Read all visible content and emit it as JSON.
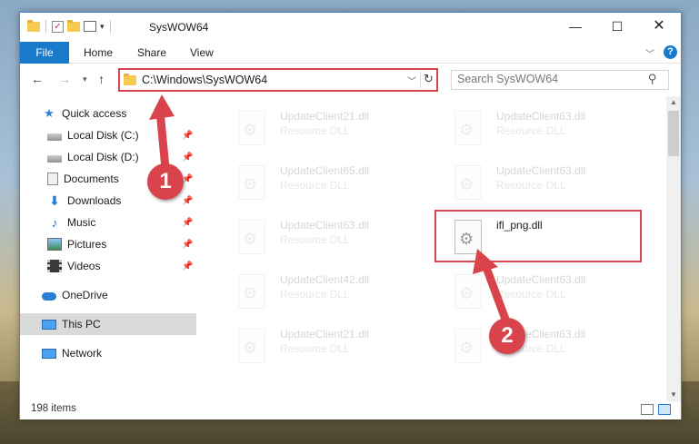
{
  "window": {
    "title": "SysWOW64",
    "minimize_glyph": "—",
    "maximize_glyph": "☐",
    "close_glyph": "✕"
  },
  "ribbon": {
    "tabs": [
      "File",
      "Home",
      "Share",
      "View"
    ],
    "help_glyph": "?"
  },
  "navigation": {
    "address": "C:\\Windows\\SysWOW64",
    "search_placeholder": "Search SysWOW64"
  },
  "sidebar": {
    "items": [
      {
        "label": "Quick access",
        "icon": "star-icon",
        "pinned": false
      },
      {
        "label": "Local Disk (C:)",
        "icon": "drive-icon",
        "pinned": true
      },
      {
        "label": "Local Disk (D:)",
        "icon": "drive-icon",
        "pinned": true
      },
      {
        "label": "Documents",
        "icon": "documents-icon",
        "pinned": true
      },
      {
        "label": "Downloads",
        "icon": "downloads-icon",
        "pinned": true
      },
      {
        "label": "Music",
        "icon": "music-icon",
        "pinned": true
      },
      {
        "label": "Pictures",
        "icon": "pictures-icon",
        "pinned": true
      },
      {
        "label": "Videos",
        "icon": "videos-icon",
        "pinned": true
      },
      {
        "label": "OneDrive",
        "icon": "onedrive-icon",
        "pinned": false
      },
      {
        "label": "This PC",
        "icon": "this-pc-icon",
        "pinned": false,
        "selected": true
      },
      {
        "label": "Network",
        "icon": "network-icon",
        "pinned": false
      }
    ]
  },
  "files": [
    {
      "name": "UpdateClient21.dll",
      "type": "Resource DLL",
      "faded": true
    },
    {
      "name": "UpdateClient63.dll",
      "type": "Resource DLL",
      "faded": true
    },
    {
      "name": "UpdateClient65.dll",
      "type": "Resource DLL",
      "faded": true
    },
    {
      "name": "UpdateClient63.dll",
      "type": "Resource DLL",
      "faded": true
    },
    {
      "name": "UpdateClient63.dll",
      "type": "Resource DLL",
      "faded": true
    },
    {
      "name": "ifl_png.dll",
      "type": "",
      "faded": false
    },
    {
      "name": "UpdateClient42.dll",
      "type": "Resource DLL",
      "faded": true
    },
    {
      "name": "UpdateClient63.dll",
      "type": "Resource DLL",
      "faded": true
    },
    {
      "name": "UpdateClient21.dll",
      "type": "Resource DLL",
      "faded": true
    },
    {
      "name": "UpdateClient63.dll",
      "type": "Resource DLL",
      "faded": true
    }
  ],
  "status": {
    "item_count": "198 items"
  },
  "annotations": {
    "step1": "1",
    "step2": "2"
  },
  "colors": {
    "accent": "#1979ca",
    "highlight": "#d9434c"
  }
}
